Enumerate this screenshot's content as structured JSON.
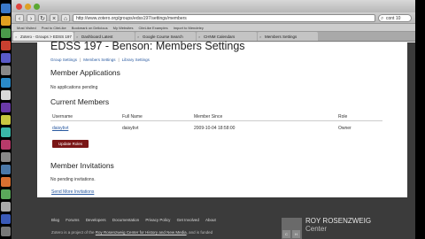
{
  "browser": {
    "url": "http://www.zotero.org/groups/edss197/settings/members",
    "search_value": "cont 10",
    "bookmarks": [
      "Most Visited",
      "Post to CiteLike",
      "Bookmark on Delicious",
      "My Websites",
      "CiteLike Examples",
      "Import to Mendeley"
    ],
    "tabs": [
      "Zotero - Groups > EDSS 197",
      "Dashboard Latest",
      "Google Course Search",
      "CHNM Calendars",
      "Members Settings"
    ]
  },
  "page": {
    "title": "EDSS 197 - Benson: Members Settings",
    "breadcrumbs": [
      "Group Settings",
      "Members Settings",
      "Library Settings"
    ],
    "member_applications": {
      "heading": "Member Applications",
      "empty": "No applications pending"
    },
    "current_members": {
      "heading": "Current Members",
      "columns": [
        "Username",
        "Full Name",
        "Member Since",
        "Role"
      ],
      "rows": [
        {
          "username": "daisybvt",
          "full_name": "daisybvt",
          "member_since": "2009-10-04 18:58:00",
          "role": "Owner"
        }
      ],
      "update_button": "Update Roles"
    },
    "member_invitations": {
      "heading": "Member Invitations",
      "empty": "No pending invitations.",
      "send_link": "Send More Invitations"
    }
  },
  "footer": {
    "links": [
      "Blog",
      "Forums",
      "Developers",
      "Documentation",
      "Privacy Policy",
      "Get Involved",
      "About"
    ],
    "note_prefix": "Zotero is a project of the",
    "note_link": "Roy Rosenzweig Center for History and New Media",
    "note_suffix": ", and is funded",
    "logo_text": "ROY ROSENZWEIG",
    "logo_sub": "Center",
    "logo_letters": [
      "C",
      "H"
    ]
  },
  "colors": {
    "accent_red": "#7a1616",
    "link_blue": "#2a5aa0"
  }
}
